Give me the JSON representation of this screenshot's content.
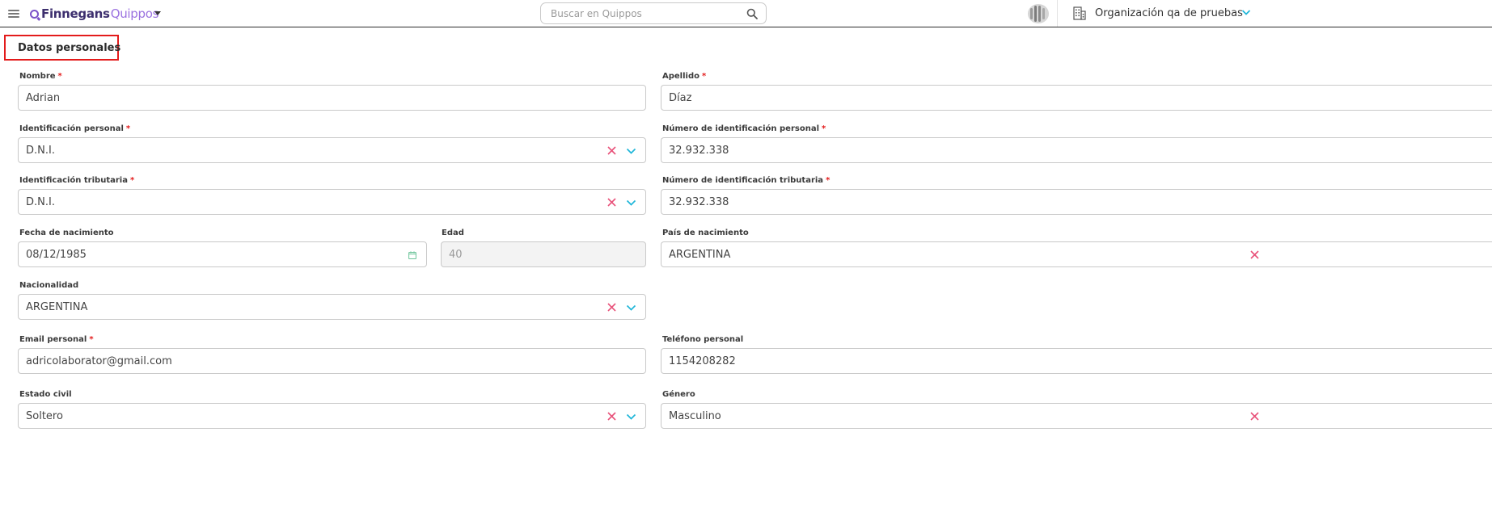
{
  "header": {
    "brand_primary": "Finnegans",
    "brand_secondary": "Quippos",
    "search_placeholder": "Buscar en Quippos",
    "organization": "Organización qa de pruebas"
  },
  "section": {
    "title": "Datos personales"
  },
  "fields": {
    "nombre": {
      "label": "Nombre",
      "required": "*",
      "value": "Adrian"
    },
    "apellido": {
      "label": "Apellido",
      "required": "*",
      "value": "Díaz"
    },
    "identificacion_personal": {
      "label": "Identificación personal",
      "required": "*",
      "value": "D.N.I."
    },
    "numero_identificacion_personal": {
      "label": "Número de identificación personal",
      "required": "*",
      "value": "32.932.338"
    },
    "identificacion_tributaria": {
      "label": "Identificación tributaria",
      "required": "*",
      "value": "D.N.I."
    },
    "numero_identificacion_tributaria": {
      "label": "Número de identificación tributaria",
      "required": "*",
      "value": "32.932.338"
    },
    "fecha_nacimiento": {
      "label": "Fecha de nacimiento",
      "value": "08/12/1985"
    },
    "edad": {
      "label": "Edad",
      "value": "40"
    },
    "pais_nacimiento": {
      "label": "País de nacimiento",
      "value": "ARGENTINA"
    },
    "nacionalidad": {
      "label": "Nacionalidad",
      "value": "ARGENTINA"
    },
    "email_personal": {
      "label": "Email personal",
      "required": "*",
      "value": "adricolaborator@gmail.com"
    },
    "telefono_personal": {
      "label": "Teléfono personal",
      "value": "1154208282"
    },
    "estado_civil": {
      "label": "Estado civil",
      "value": "Soltero"
    },
    "genero": {
      "label": "Género",
      "value": "Masculino"
    }
  },
  "colors": {
    "brand_dark": "#3d2f6e",
    "brand_light": "#9b72e0",
    "required": "#e31b1b",
    "clear_icon": "#e8527a",
    "chevron": "#1fb6d9",
    "calendar_icon": "#6cc49a"
  },
  "icons": {
    "menu": "hamburger-icon",
    "search": "search-icon",
    "organization": "building-icon",
    "clear": "close-icon",
    "dropdown": "chevron-down-icon",
    "date": "calendar-icon"
  }
}
